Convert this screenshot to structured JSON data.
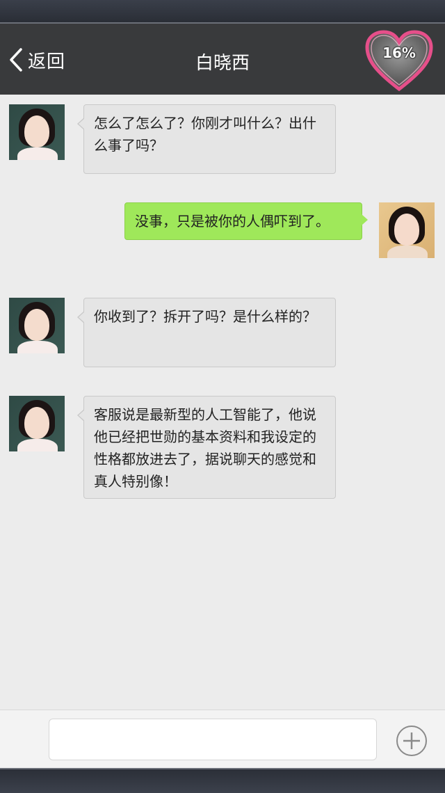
{
  "header": {
    "back_label": "返回",
    "title": "白晓西",
    "affection_percent": "16%"
  },
  "messages": [
    {
      "side": "left",
      "avatar": "girl",
      "text": "怎么了怎么了？你刚才叫什么？出什么事了吗？"
    },
    {
      "side": "right",
      "avatar": "me",
      "text": "没事，只是被你的人偶吓到了。"
    },
    {
      "side": "left",
      "avatar": "girl",
      "text": "你收到了？拆开了吗？是什么样的？"
    },
    {
      "side": "left",
      "avatar": "girl",
      "text": "客服说是最新型的人工智能了，他说他已经把世勋的基本资料和我设定的性格都放进去了，据说聊天的感觉和真人特别像！"
    }
  ],
  "input": {
    "value": "",
    "placeholder": ""
  },
  "icons": {
    "back": "chevron-left-icon",
    "heart": "heart-icon",
    "add": "plus-circle-icon"
  },
  "colors": {
    "header": "#393a3c",
    "sent_bubble": "#9fe85a",
    "received_bubble": "#e5e5e5",
    "heart_border": "#e64f8a"
  }
}
